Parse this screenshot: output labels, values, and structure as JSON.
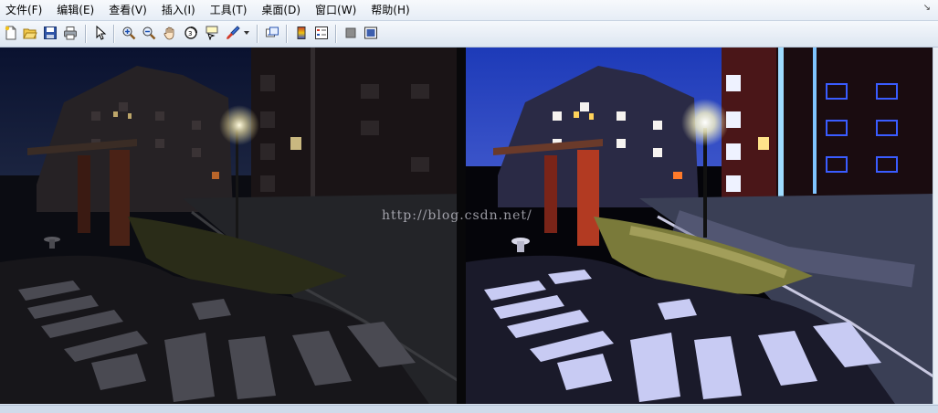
{
  "menu": {
    "items": [
      {
        "label": "文件(F)"
      },
      {
        "label": "编辑(E)"
      },
      {
        "label": "查看(V)"
      },
      {
        "label": "插入(I)"
      },
      {
        "label": "工具(T)"
      },
      {
        "label": "桌面(D)"
      },
      {
        "label": "窗口(W)"
      },
      {
        "label": "帮助(H)"
      }
    ],
    "restore_icon": "restore-window-icon"
  },
  "toolbar": {
    "icons": [
      "new-figure-icon",
      "open-file-icon",
      "save-icon",
      "print-icon",
      "arrow-select-icon",
      "zoom-in-icon",
      "zoom-out-icon",
      "pan-hand-icon",
      "rotate-3d-icon",
      "data-cursor-icon",
      "brush-icon",
      "dropdown-arrow-icon",
      "link-plot-icon",
      "colorbar-icon",
      "legend-icon",
      "hide-plot-tools-icon",
      "show-plot-tools-icon"
    ]
  },
  "figure": {
    "watermark": "http://blog.csdn.net/",
    "left_image": "original-night-photo",
    "right_image": "enhanced-night-photo"
  }
}
